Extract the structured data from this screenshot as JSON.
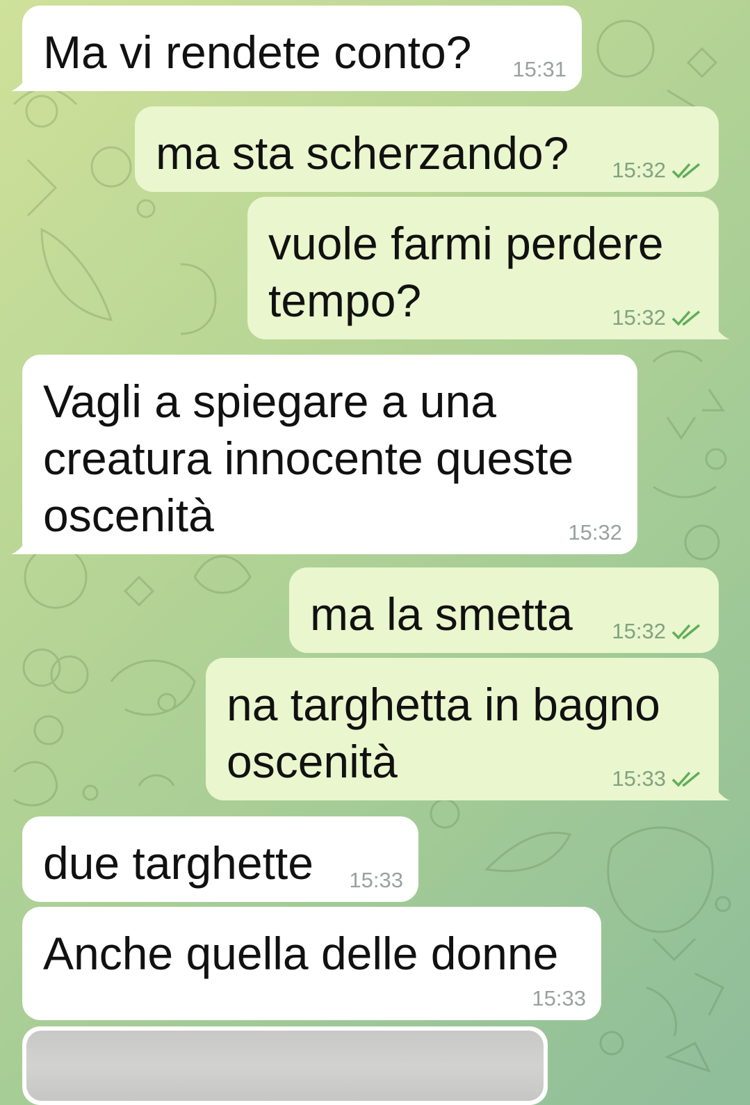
{
  "messages": [
    {
      "id": "m1",
      "direction": "incoming",
      "text": "Ma vi rendete conto?",
      "time": "15:31",
      "read": false
    },
    {
      "id": "m2",
      "direction": "outgoing",
      "text": "ma sta scherzando?",
      "time": "15:32",
      "read": true
    },
    {
      "id": "m3",
      "direction": "outgoing",
      "text": "vuole farmi perdere\ntempo?",
      "time": "15:32",
      "read": true
    },
    {
      "id": "m4",
      "direction": "incoming",
      "text": "Vagli a spiegare a una\ncreatura innocente queste\noscenità",
      "time": "15:32",
      "read": false
    },
    {
      "id": "m5",
      "direction": "outgoing",
      "text": "ma la smetta",
      "time": "15:32",
      "read": true
    },
    {
      "id": "m6",
      "direction": "outgoing",
      "text": "na targhetta in bagno\noscenità",
      "time": "15:33",
      "read": true
    },
    {
      "id": "m7",
      "direction": "incoming",
      "text": "due targhette",
      "time": "15:33",
      "read": false
    },
    {
      "id": "m8",
      "direction": "incoming",
      "text": "Anche quella delle donne",
      "time": "15:33",
      "read": false
    }
  ],
  "attachment": {
    "type": "photo",
    "icon": "photo-thumbnail"
  },
  "colors": {
    "incoming_bubble": "#ffffff",
    "outgoing_bubble": "#eaf6cd",
    "read_ticks": "#5fae5a",
    "time_incoming": "#9aa0a0",
    "time_outgoing": "#7fa380"
  }
}
